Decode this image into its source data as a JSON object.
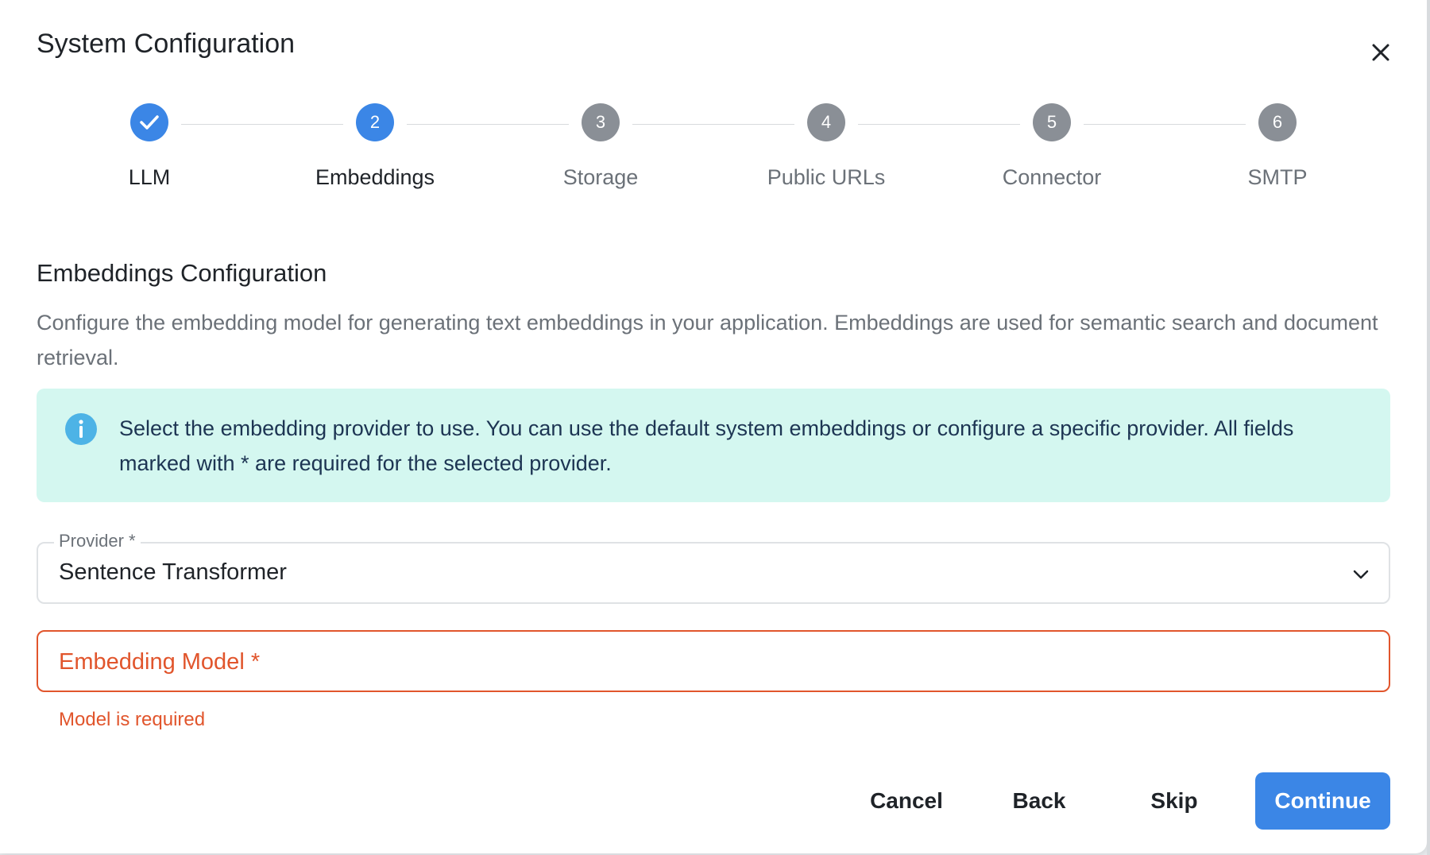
{
  "dialog": {
    "title": "System Configuration",
    "close_icon": "close-icon"
  },
  "stepper": {
    "steps": [
      {
        "number": "",
        "label": "LLM",
        "state": "completed",
        "icon": "check-icon"
      },
      {
        "number": "2",
        "label": "Embeddings",
        "state": "active"
      },
      {
        "number": "3",
        "label": "Storage",
        "state": "pending"
      },
      {
        "number": "4",
        "label": "Public URLs",
        "state": "pending"
      },
      {
        "number": "5",
        "label": "Connector",
        "state": "pending"
      },
      {
        "number": "6",
        "label": "SMTP",
        "state": "pending"
      }
    ]
  },
  "section": {
    "title": "Embeddings Configuration",
    "description": "Configure the embedding model for generating text embeddings in your application. Embeddings are used for semantic search and document retrieval."
  },
  "info": {
    "icon": "info-icon",
    "text": "Select the embedding provider to use. You can use the default system embeddings or configure a specific provider. All fields marked with * are required for the selected provider."
  },
  "form": {
    "provider": {
      "label": "Provider *",
      "value": "Sentence Transformer"
    },
    "embedding_model": {
      "placeholder": "Embedding Model *",
      "value": "",
      "error": "Model is required"
    }
  },
  "actions": {
    "cancel": "Cancel",
    "back": "Back",
    "skip": "Skip",
    "continue": "Continue"
  },
  "colors": {
    "primary": "#3b86e6",
    "pending_step": "#8a8f96",
    "error": "#e1552c",
    "info_background": "#d4f7f0",
    "info_icon": "#4db3e6"
  }
}
